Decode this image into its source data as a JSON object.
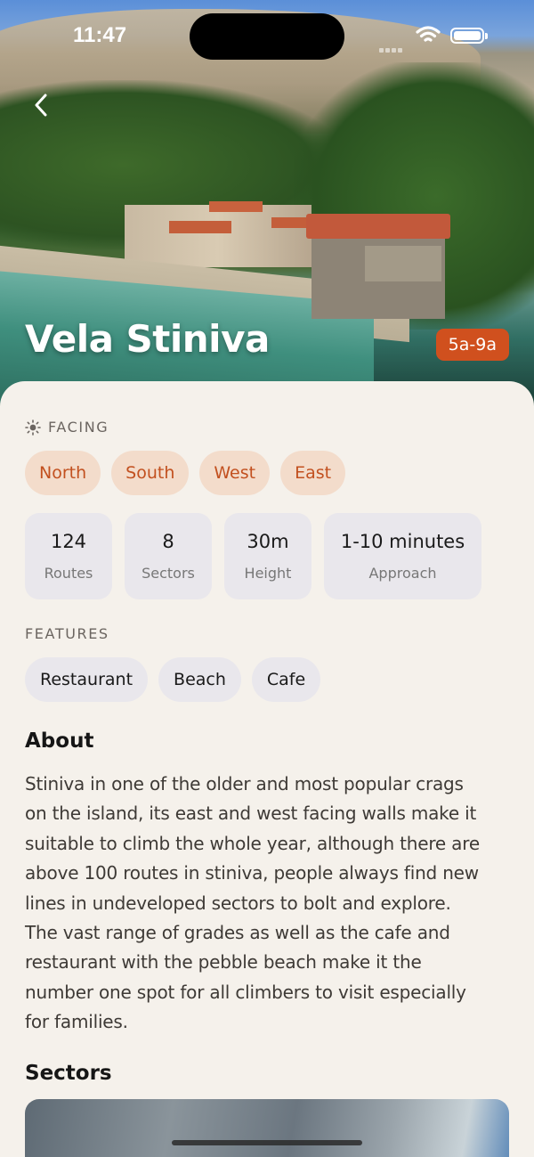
{
  "status_bar": {
    "time": "11:47"
  },
  "hero": {
    "title": "Vela Stiniva",
    "grade": "5a-9a"
  },
  "facing": {
    "label": "FACING",
    "directions": [
      "North",
      "South",
      "West",
      "East"
    ]
  },
  "stats": [
    {
      "value": "124",
      "label": "Routes"
    },
    {
      "value": "8",
      "label": "Sectors"
    },
    {
      "value": "30m",
      "label": "Height"
    },
    {
      "value": "1-10 minutes",
      "label": "Approach"
    }
  ],
  "features": {
    "label": "FEATURES",
    "items": [
      "Restaurant",
      "Beach",
      "Cafe"
    ]
  },
  "about": {
    "heading": "About",
    "lines": [
      "Stiniva in one of the older and most popular crags",
      "on the island, its east and west facing walls make it",
      "suitable to climb the whole year, although there are",
      "above 100 routes in stiniva, people always find new",
      "lines in undeveloped sectors to bolt and explore.",
      "The vast range of grades as well as the cafe and",
      "restaurant with the pebble beach make it the",
      "number one spot for all climbers to visit especially",
      "for families."
    ]
  },
  "sectors": {
    "heading": "Sectors"
  },
  "colors": {
    "accent": "#d0501e",
    "chip_bg": "#f3dccb",
    "chip_text": "#c2501f",
    "card_bg": "#e9e7ec",
    "sheet_bg": "#f5f1eb"
  }
}
